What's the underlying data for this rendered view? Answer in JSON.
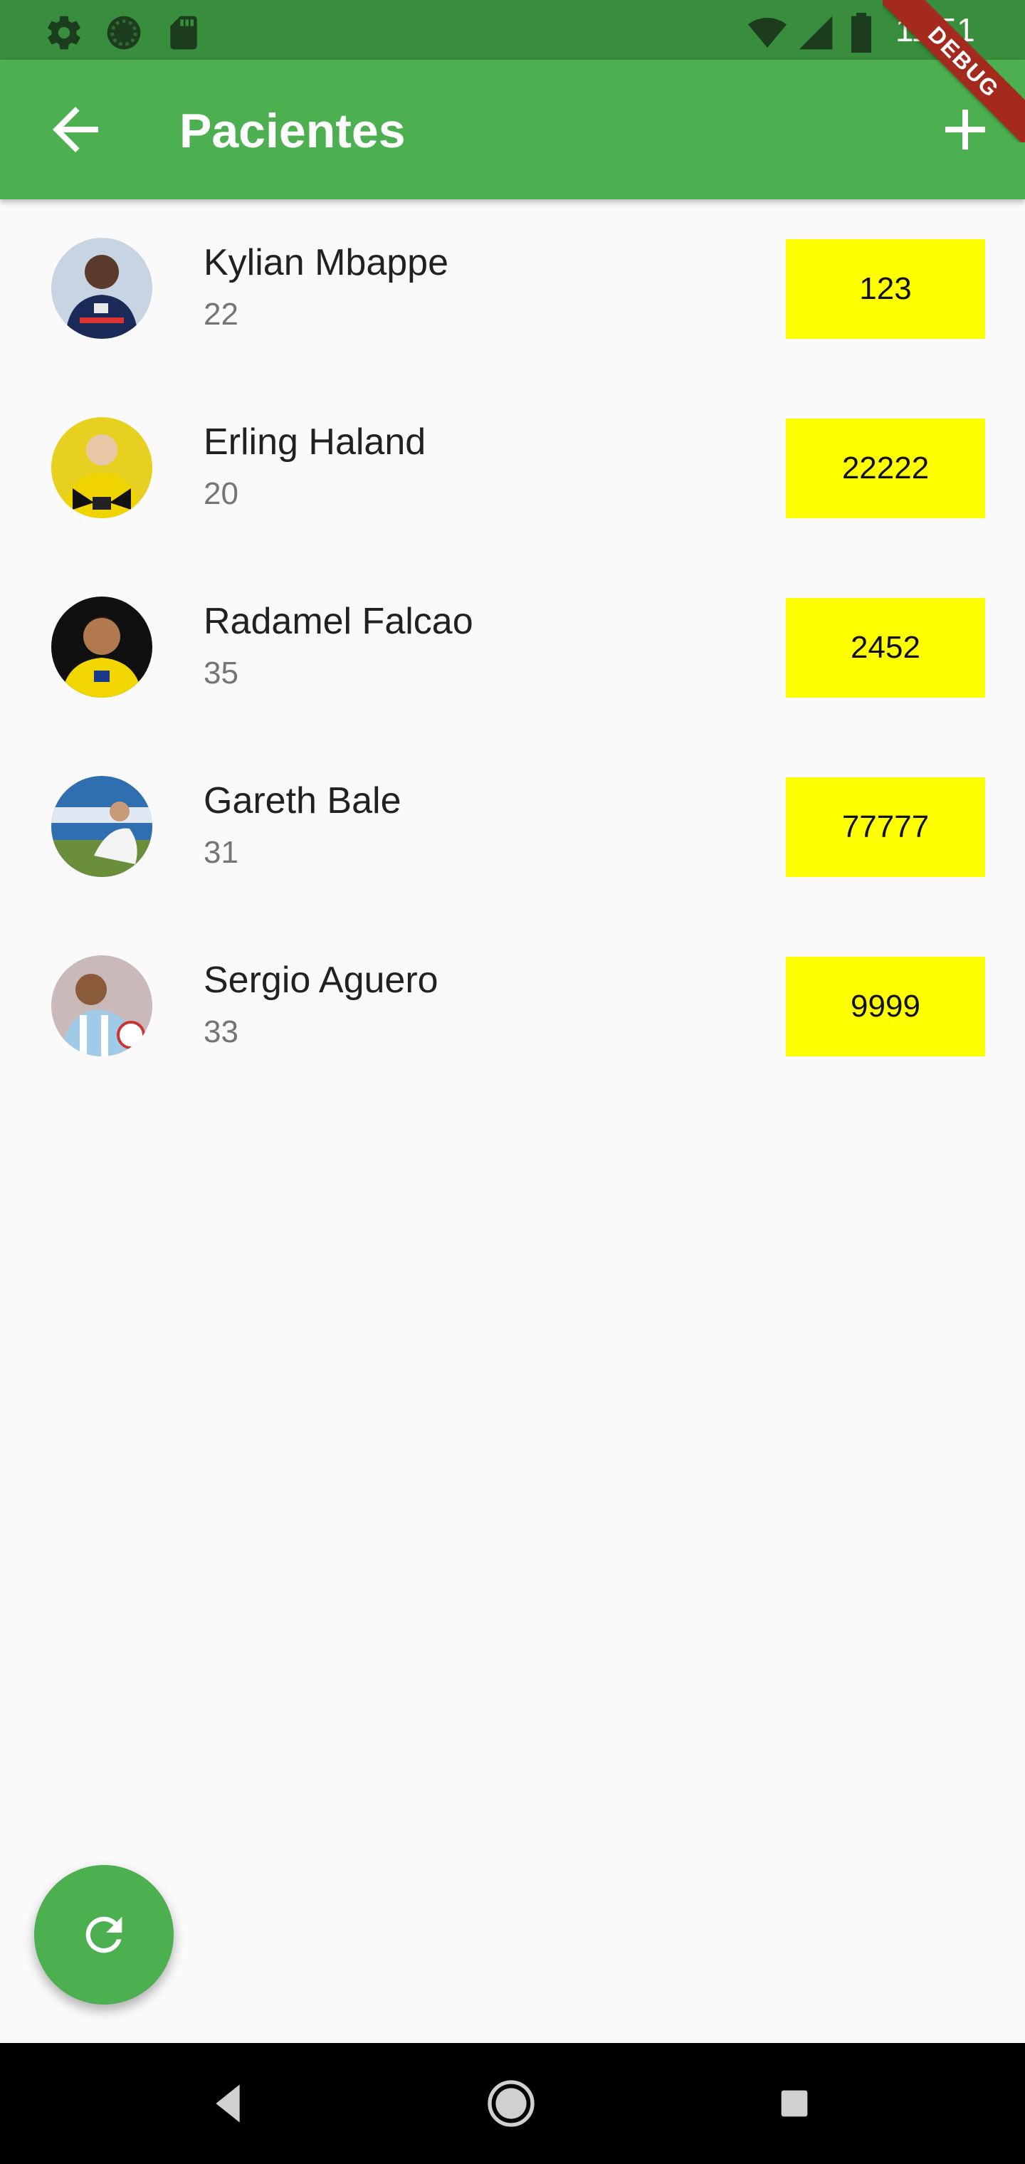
{
  "status_bar": {
    "time": "11:51",
    "icons": [
      "settings-icon",
      "loading-circle-icon",
      "sd-card-icon",
      "wifi-icon",
      "signal-icon",
      "battery-icon"
    ]
  },
  "app_bar": {
    "title": "Pacientes",
    "back_icon": "arrow-back-icon",
    "add_icon": "add-icon",
    "color": "#4caf50"
  },
  "debug_banner": {
    "label": "DEBUG"
  },
  "patients": [
    {
      "name": "Kylian Mbappe",
      "age": "22",
      "value": "123"
    },
    {
      "name": "Erling Haland",
      "age": "20",
      "value": "22222"
    },
    {
      "name": "Radamel Falcao",
      "age": "35",
      "value": "2452"
    },
    {
      "name": "Gareth Bale",
      "age": "31",
      "value": "77777"
    },
    {
      "name": "Sergio Aguero",
      "age": "33",
      "value": "9999"
    }
  ],
  "fab": {
    "icon": "refresh-icon"
  },
  "nav_bar": {
    "icons": [
      "nav-back-icon",
      "nav-home-icon",
      "nav-recents-icon"
    ]
  },
  "colors": {
    "status_bar": "#388e3c",
    "accent": "#4caf50",
    "value_box": "#ffff00"
  }
}
